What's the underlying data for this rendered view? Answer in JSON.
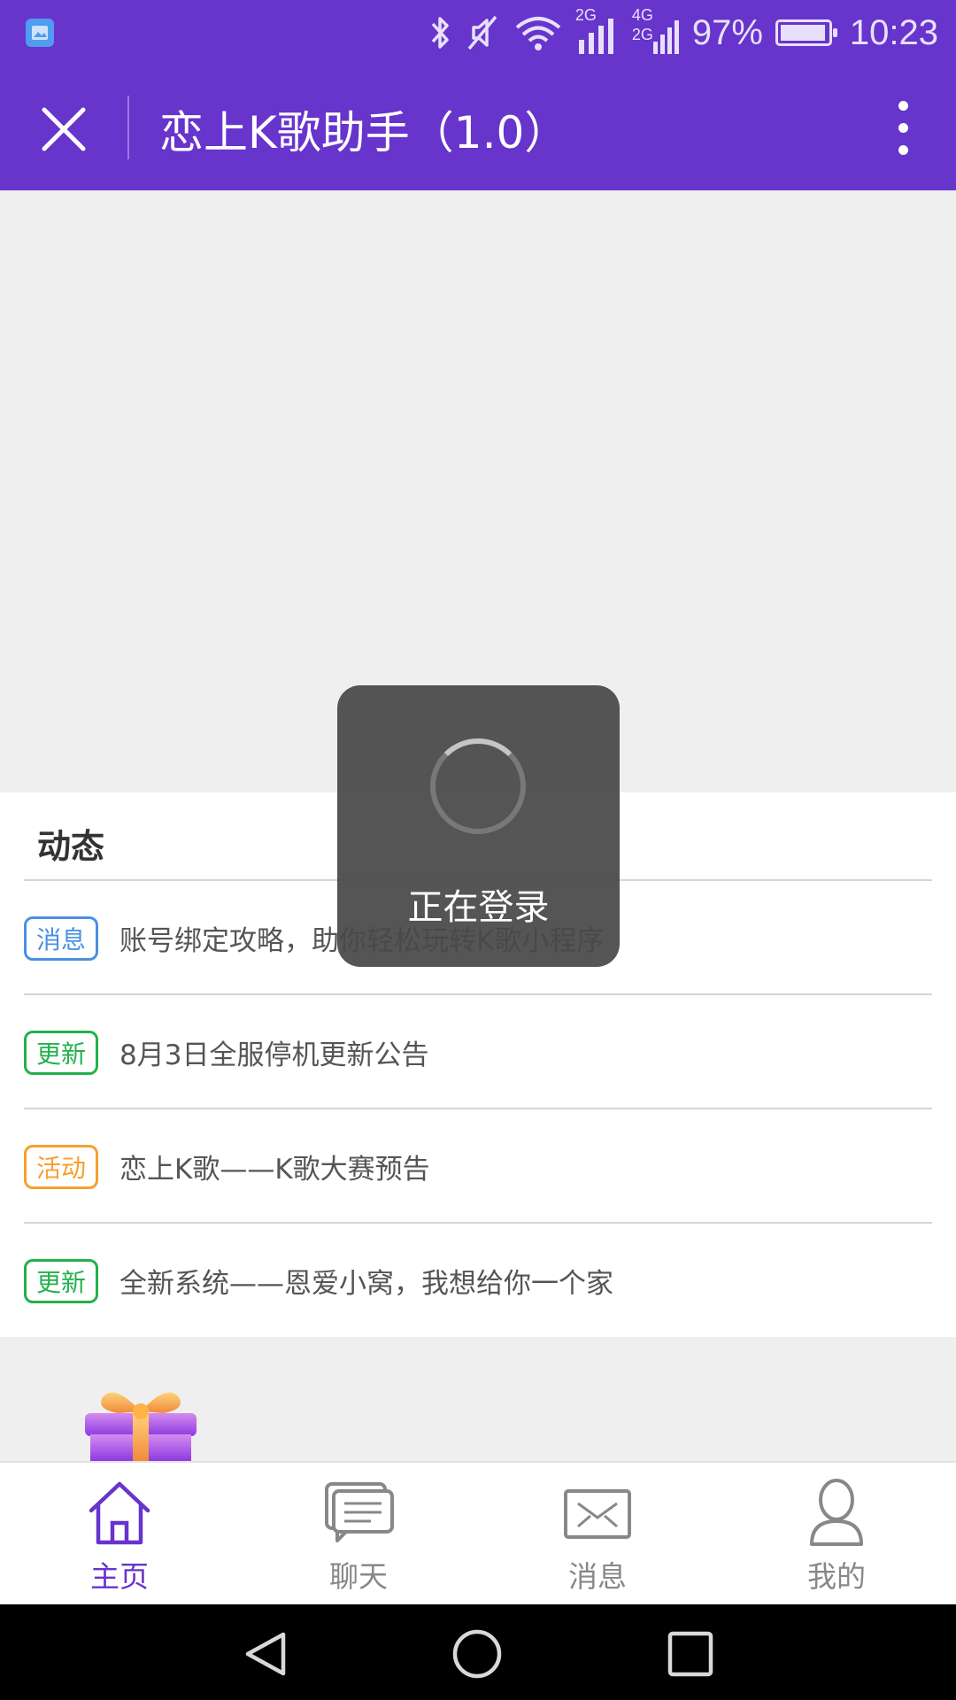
{
  "status_bar": {
    "network_1": "2G",
    "network_2a": "4G",
    "network_2b": "2G",
    "battery": "97%",
    "battery_level": 0.97,
    "time": "10:23"
  },
  "header": {
    "title": "恋上K歌助手（1.0）"
  },
  "news": {
    "heading": "动态",
    "items": [
      {
        "tag": "消息",
        "tag_color": "#4a90e2",
        "text": "账号绑定攻略，助你轻松玩转K歌小程序"
      },
      {
        "tag": "更新",
        "tag_color": "#22b14c",
        "text": "8月3日全服停机更新公告"
      },
      {
        "tag": "活动",
        "tag_color": "#f5a030",
        "text": "恋上K歌——K歌大赛预告"
      },
      {
        "tag": "更新",
        "tag_color": "#22b14c",
        "text": "全新系统——恩爱小窝，我想给你一个家"
      }
    ]
  },
  "tabs": [
    {
      "label": "主页",
      "icon": "home-icon",
      "active": true
    },
    {
      "label": "聊天",
      "icon": "chat-icon",
      "active": false
    },
    {
      "label": "消息",
      "icon": "mail-icon",
      "active": false
    },
    {
      "label": "我的",
      "icon": "profile-icon",
      "active": false
    }
  ],
  "loading": {
    "text": "正在登录"
  },
  "colors": {
    "brand": "#6734cc",
    "tab_inactive": "#888888"
  }
}
